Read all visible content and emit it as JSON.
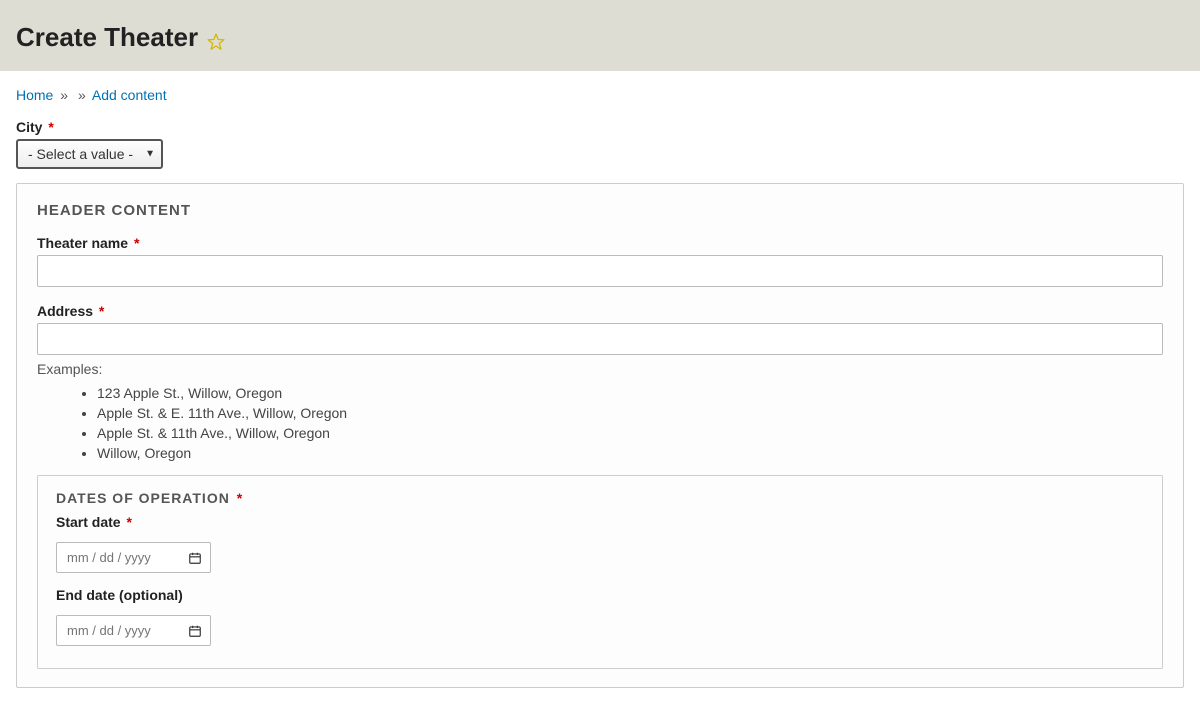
{
  "header": {
    "title": "Create Theater"
  },
  "breadcrumb": {
    "home": "Home",
    "addContent": "Add content"
  },
  "form": {
    "city": {
      "label": "City",
      "placeholder": "- Select a value -"
    },
    "headerContent": {
      "heading": "HEADER CONTENT",
      "theaterName": {
        "label": "Theater name",
        "value": ""
      },
      "address": {
        "label": "Address",
        "value": "",
        "examplesLabel": "Examples:",
        "examples": [
          "123 Apple St., Willow, Oregon",
          "Apple St. & E. 11th Ave., Willow, Oregon",
          "Apple St. & 11th Ave., Willow, Oregon",
          "Willow, Oregon"
        ]
      },
      "dates": {
        "heading": "DATES OF OPERATION",
        "startLabel": "Start date",
        "endLabel": "End date (optional)",
        "placeholder": "mm / dd / yyyy"
      }
    }
  }
}
